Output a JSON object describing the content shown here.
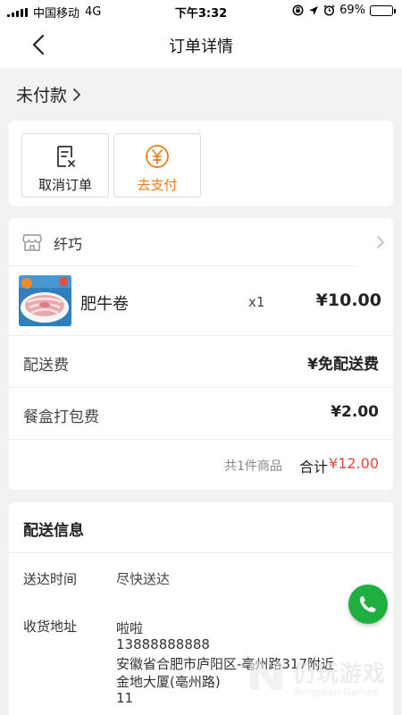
{
  "status_bar": {
    "carrier": "中国移动",
    "network": "4G",
    "time": "下午3:32",
    "battery": "69%",
    "battery_level": 0.69
  },
  "nav": {
    "back_icon": "chevron-left-icon",
    "title": "订单详情"
  },
  "order_status": {
    "label": "未付款",
    "icon": "chevron-right-icon"
  },
  "actions": {
    "cancel_label": "取消订单",
    "cancel_icon": "cancel-order-icon",
    "pay_label": "去支付",
    "pay_icon": "yen-circle-icon",
    "pay_color": "#e8801c"
  },
  "shop": {
    "icon": "shop-icon",
    "name": "纤巧"
  },
  "items": [
    {
      "name": "肥牛卷",
      "qty": "x1",
      "price": "¥10.00"
    }
  ],
  "fees": [
    {
      "label": "配送费",
      "value": "¥免配送费"
    },
    {
      "label": "餐盒打包费",
      "value": "¥2.00"
    }
  ],
  "summary": {
    "count_text": "共1件商品",
    "total_label": "合计",
    "total_value": "¥12.00",
    "total_color": "#e34b3c"
  },
  "delivery": {
    "title": "配送信息",
    "time_label": "送达时间",
    "time_value": "尽快送达",
    "address_label": "收货地址",
    "address_lines": [
      "啦啦",
      "13888888888",
      "安徽省合肥市庐阳区-亳州路317附近",
      "金地大厦(亳州路)",
      "11"
    ]
  },
  "fab": {
    "icon": "phone-icon",
    "color": "#1fae40"
  },
  "watermark": {
    "text": "仍玩游戏",
    "sub": "Rengwan Games"
  }
}
